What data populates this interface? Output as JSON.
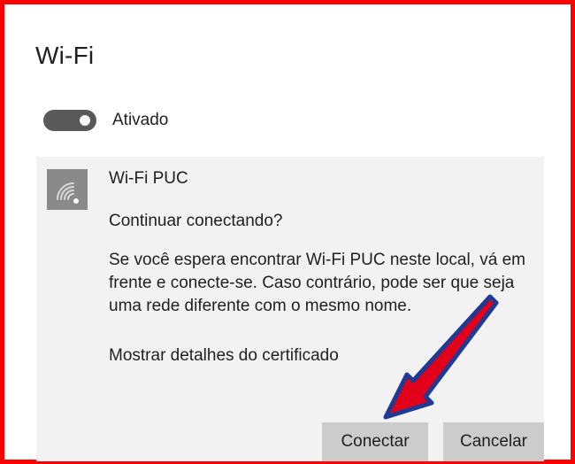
{
  "header": {
    "title": "Wi-Fi"
  },
  "wifi_toggle": {
    "state_label": "Ativado",
    "is_on": true
  },
  "network": {
    "name": "Wi-Fi PUC",
    "icon": "wifi-signal-icon",
    "question": "Continuar conectando?",
    "message": "Se você espera encontrar Wi-Fi PUC neste local, vá em frente e conecte-se. Caso contrário, pode ser que seja uma rede diferente com o mesmo nome.",
    "certificate_link": "Mostrar detalhes do certificado"
  },
  "actions": {
    "connect_label": "Conectar",
    "cancel_label": "Cancelar"
  },
  "colors": {
    "frame_border": "#ff0000",
    "panel_background": "#f2f2f2",
    "button_background": "#cccccc",
    "toggle_on": "#595959",
    "annotation_arrow_fill": "#e3001b",
    "annotation_arrow_outline": "#1f3a93"
  }
}
